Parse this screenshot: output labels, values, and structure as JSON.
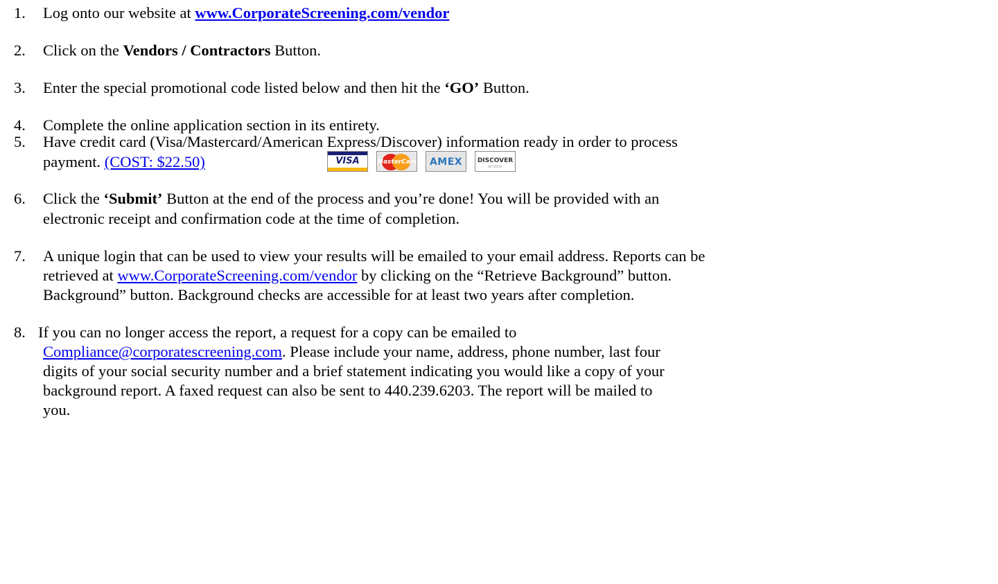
{
  "steps": [
    {
      "number": "1.",
      "text": "Log onto our website at ",
      "link": "www.CorporateScreening.com/vendor"
    },
    {
      "number": "2.",
      "before": "Click on the ",
      "bold": "Vendors / Contractors",
      "after": " Button."
    },
    {
      "number": "3.",
      "before": "Enter the special promotional code listed below and then hit the ",
      "bold": "‘GO’",
      "after": " Button."
    },
    {
      "number": "4.",
      "text": "Complete the online application section in its entirety."
    },
    {
      "number": "5.",
      "line1": "Have credit card (Visa/Mastercard/American Express/Discover) information ready in order to process",
      "line2": "payment. ",
      "cost_link": "(COST: $22.50)",
      "cards": [
        {
          "icon": "visa-icon",
          "label": "VISA"
        },
        {
          "icon": "mastercard-icon",
          "label": "MasterCard"
        },
        {
          "icon": "amex-icon",
          "label": "AMEX"
        },
        {
          "icon": "discover-icon",
          "label": "DISCOVER",
          "sub": "NETWORK"
        }
      ]
    },
    {
      "number": "6.",
      "before": "Click the ",
      "bold": "‘Submit’",
      "after": " Button at the end of the process and you’re done!  You will be provided with an",
      "line2": "electronic receipt and confirmation code at the time of completion."
    },
    {
      "number": "7.",
      "line1": "A unique login that can be used to view your results will be emailed to your email address.  Reports can be",
      "line2_before": "retrieved at ",
      "line2_link": "www.CorporateScreening.com/vendor",
      "line2_after": " by clicking on the “Retrieve Background” button.",
      "line3": "Background” button. Background checks are accessible for at least two years after completion."
    },
    {
      "number": "8.",
      "line1": " If you can no longer access the report, a request for a copy can be emailed to",
      "line2_link": "Compliance@corporatescreening.com",
      "line2_after": ". Please include your name, address, phone number, last four",
      "line3": "digits of your social security number and a brief statement indicating you would like a copy of your",
      "line4": "background report. A faxed request can also be sent to 440.239.6203. The report will be mailed to",
      "line5": "you."
    }
  ]
}
